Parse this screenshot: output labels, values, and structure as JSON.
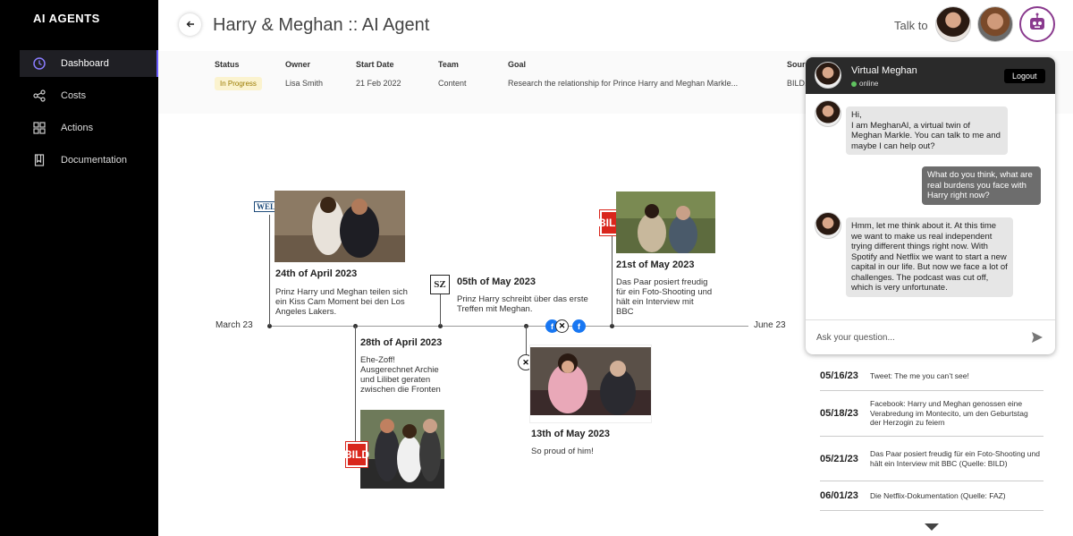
{
  "sidebar": {
    "brand": "AI AGENTS",
    "items": [
      {
        "label": "Dashboard"
      },
      {
        "label": "Costs"
      },
      {
        "label": "Actions"
      },
      {
        "label": "Documentation"
      }
    ]
  },
  "header": {
    "title": "Harry & Meghan :: AI Agent",
    "talk_to": "Talk to"
  },
  "meta": {
    "headers": {
      "status": "Status",
      "owner": "Owner",
      "start_date": "Start Date",
      "team": "Team",
      "goal": "Goal",
      "source": "Sourc"
    },
    "values": {
      "status": "In Progress",
      "owner": "Lisa Smith",
      "start_date": "21 Feb 2022",
      "team": "Content",
      "goal": "Research the relationship for Prince Harry and Meghan Markle...",
      "source": "BILD,"
    }
  },
  "timeline": {
    "start": "March 23",
    "end": "June 23",
    "events": [
      {
        "source": "WELT",
        "date": "24th of April 2023",
        "text": "Prinz Harry und Meghan teilen sich ein Kiss Cam Moment bei den Los Angeles Lakers."
      },
      {
        "source": "BILD",
        "date": "28th of April 2023",
        "text": "Ehe-Zoff! Ausgerechnet Archie und Lilibet geraten zwischen die Fronten"
      },
      {
        "source": "SZ",
        "date": "05th of May 2023",
        "text": "Prinz Harry schreibt über das erste Treffen mit Meghan."
      },
      {
        "source": "X",
        "date": "13th of May 2023",
        "text": "So proud of him!"
      },
      {
        "source": "BILD",
        "date": "21st of May 2023",
        "text": "Das Paar posiert freudig für ein Foto-Shooting und hält ein Interview mit BBC"
      }
    ]
  },
  "chat": {
    "name": "Virtual Meghan",
    "status": "online",
    "logout": "Logout",
    "messages": [
      {
        "from": "bot",
        "text": "Hi,\nI am MeghanAI, a virtual twin of Meghan Markle. You can talk to me and maybe I can help out?"
      },
      {
        "from": "user",
        "text": "What do you think, what are real burdens you face with Harry right now?"
      },
      {
        "from": "bot",
        "text": "Hmm, let me think about it. At this time we want to make us real independent trying different things right now. With Spotify and Netflix we want to start a new capital in our life. But now we face a lot of challenges. The podcast was cut off, which is very unfortunate."
      }
    ],
    "placeholder": "Ask your question..."
  },
  "news": [
    {
      "date": "05/16/23",
      "text": "Tweet: The me you can’t see!"
    },
    {
      "date": "05/18/23",
      "text": "Facebook: Harry und Meghan genossen eine Verabredung im Montecito, um den Geburtstag der Herzogin zu feiern"
    },
    {
      "date": "05/21/23",
      "text": "Das Paar posiert freudig für ein Foto-Shooting und hält ein Interview mit BBC (Quelle: BILD)"
    },
    {
      "date": "06/01/23",
      "text": "Die Netflix-Dokumentation (Quelle: FAZ)"
    }
  ]
}
